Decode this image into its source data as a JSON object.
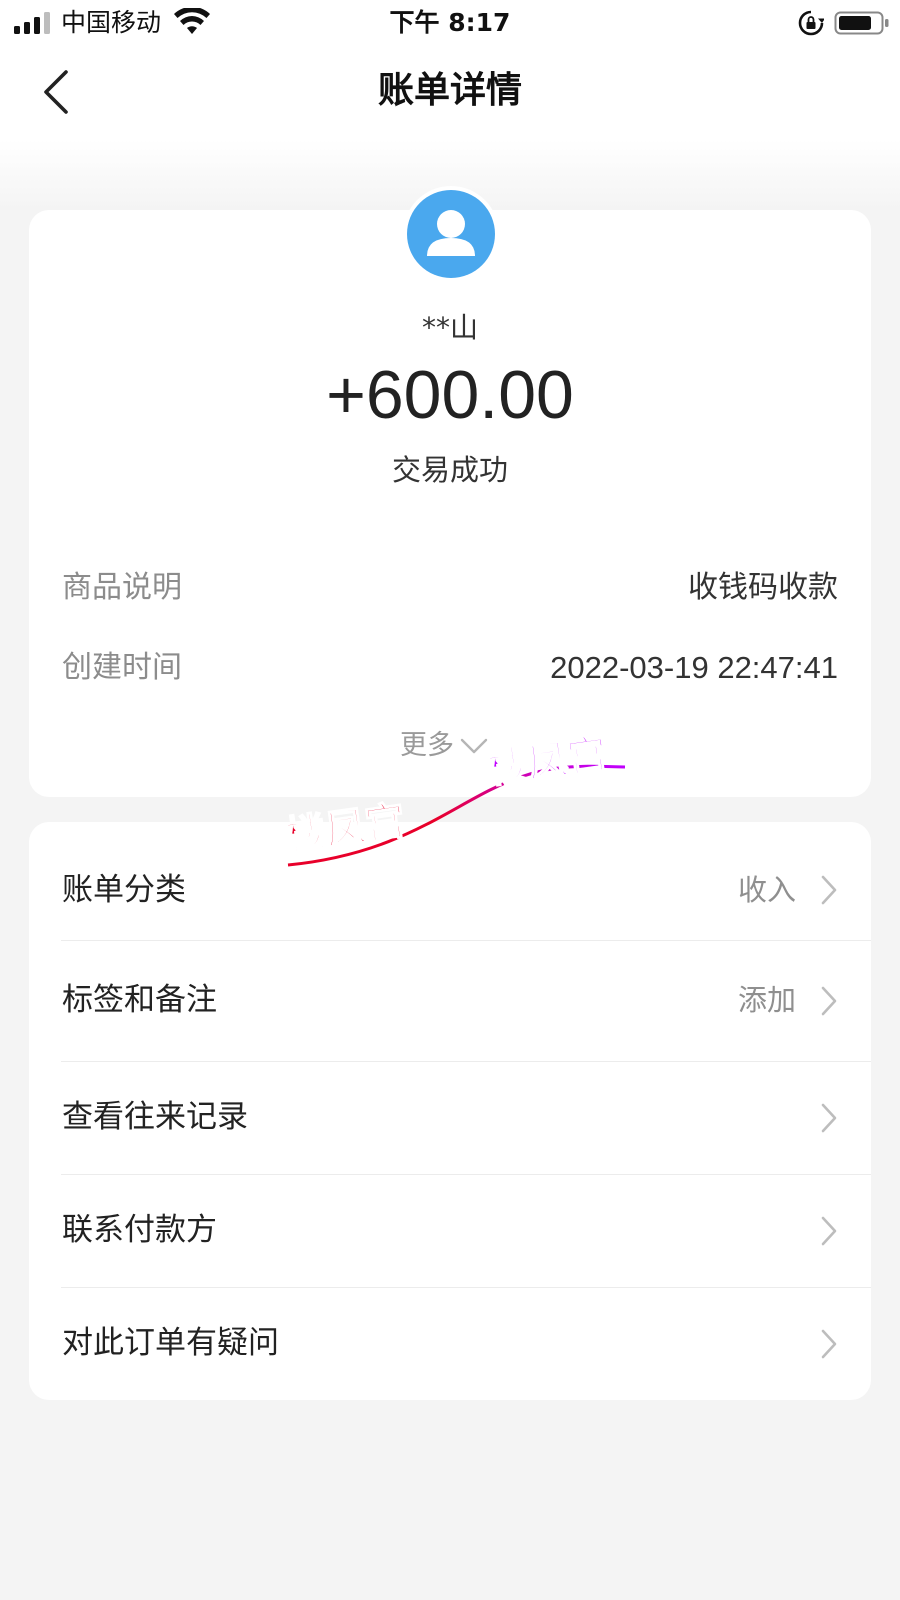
{
  "status_bar": {
    "carrier": "中国移动",
    "time": "下午 8:17",
    "icons": [
      "signal-icon",
      "wifi-icon",
      "rotation-lock-icon",
      "battery-icon"
    ]
  },
  "nav": {
    "back_icon": "chevron-left-icon",
    "title": "账单详情"
  },
  "summary": {
    "avatar_icon": "user-avatar-icon",
    "payer": "**山",
    "amount": "+600.00",
    "status": "交易成功",
    "details": [
      {
        "label": "商品说明",
        "value": "收钱码收款"
      },
      {
        "label": "创建时间",
        "value": "2022-03-19 22:47:41"
      }
    ],
    "more_label": "更多",
    "more_icon": "chevron-down-icon"
  },
  "actions": [
    {
      "label": "账单分类",
      "value": "收入"
    },
    {
      "label": "标签和备注",
      "value": "添加"
    },
    {
      "label": "查看往来记录",
      "value": ""
    },
    {
      "label": "联系付款方",
      "value": ""
    },
    {
      "label": "对此订单有疑问",
      "value": ""
    }
  ],
  "watermark": {
    "text_1": "楼凤宫",
    "text_2": "楼凤宫"
  },
  "colors": {
    "avatar_blue": "#4aa8ee",
    "page_bg": "#f4f4f4",
    "card_bg": "#ffffff",
    "secondary_text": "#8c8c8c",
    "watermark_red": "#e8002a",
    "watermark_purple": "#c000ff"
  }
}
